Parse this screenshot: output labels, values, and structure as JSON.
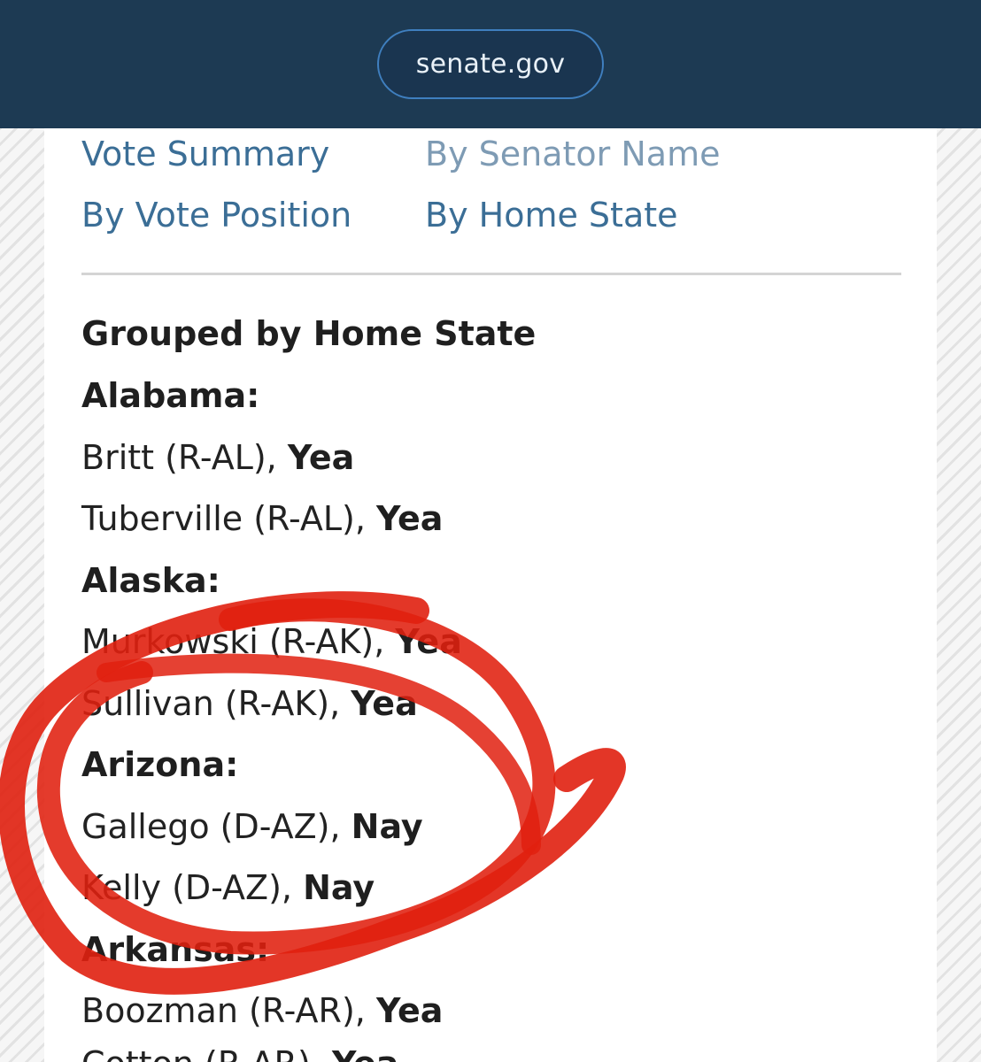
{
  "browser": {
    "url": "senate.gov"
  },
  "nav": {
    "vote_summary": "Vote Summary",
    "by_senator_name": "By Senator Name",
    "by_vote_position": "By Vote Position",
    "by_home_state": "By Home State"
  },
  "section": {
    "heading": "Grouped by Home State"
  },
  "states": [
    {
      "name": "Alabama:",
      "senators": [
        {
          "name": "Britt (R-AL), ",
          "vote": "Yea"
        },
        {
          "name": "Tuberville (R-AL), ",
          "vote": "Yea"
        }
      ]
    },
    {
      "name": "Alaska:",
      "senators": [
        {
          "name": "Murkowski (R-AK), ",
          "vote": "Yea"
        },
        {
          "name": "Sullivan (R-AK), ",
          "vote": "Yea"
        }
      ]
    },
    {
      "name": "Arizona:",
      "senators": [
        {
          "name": "Gallego (D-AZ), ",
          "vote": "Nay"
        },
        {
          "name": "Kelly (D-AZ), ",
          "vote": "Nay"
        }
      ]
    },
    {
      "name": "Arkansas:",
      "senators": [
        {
          "name": "Boozman (R-AR), ",
          "vote": "Yea"
        },
        {
          "name": "Cotton (R-AR), ",
          "vote": "Yea"
        }
      ]
    }
  ],
  "colors": {
    "header_bg": "#1d3a53",
    "link": "#3b6e96",
    "annotation": "#e0200f"
  }
}
